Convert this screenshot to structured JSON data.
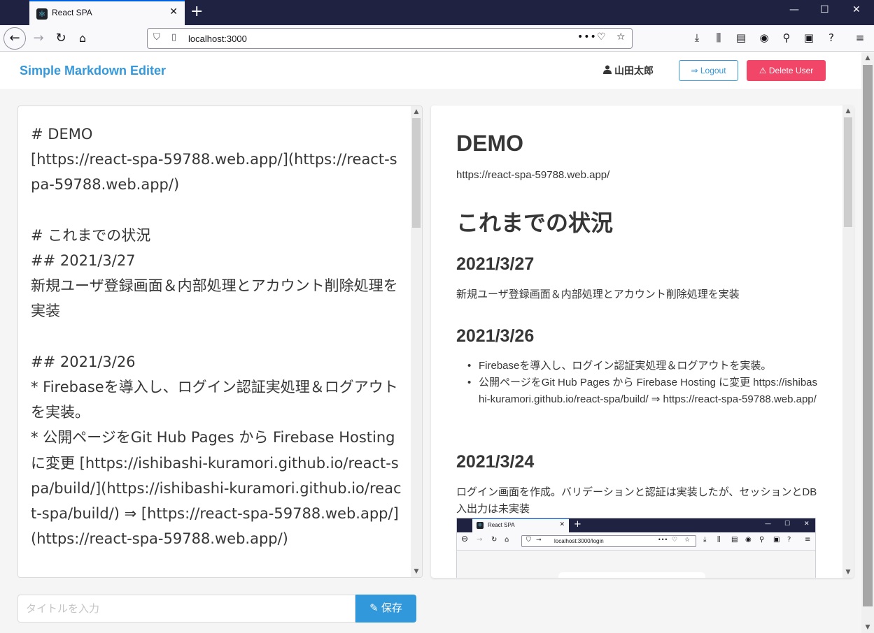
{
  "browser": {
    "tab_title": "React SPA",
    "url": "localhost:3000",
    "new_tab": "+",
    "minimize": "—",
    "maximize": "☐",
    "close": "✕"
  },
  "header": {
    "brand": "Simple Markdown Editer",
    "username": "山田太郎",
    "logout_label": "Logout",
    "delete_label": "Delete User"
  },
  "editor": {
    "content": "# DEMO\n[https://react-spa-59788.web.app/](https://react-spa-59788.web.app/)\n\n# これまでの状況\n## 2021/3/27\n新規ユーザ登録画面＆内部処理とアカウント削除処理を実装\n\n## 2021/3/26\n* Firebaseを導入し、ログイン認証実処理＆ログアウトを実装。\n* 公開ページをGit Hub Pages から Firebase Hosting に変更 [https://ishibashi-kuramori.github.io/react-spa/build/](https://ishibashi-kuramori.github.io/react-spa/build/) ⇒ [https://react-spa-59788.web.app/](https://react-spa-59788.web.app/)"
  },
  "preview": {
    "h1_demo": "DEMO",
    "demo_link": "https://react-spa-59788.web.app/",
    "h1_status": "これまでの状況",
    "sections": [
      {
        "date": "2021/3/27",
        "text": "新規ユーザ登録画面＆内部処理とアカウント削除処理を実装"
      },
      {
        "date": "2021/3/26",
        "items": [
          "Firebaseを導入し、ログイン認証実処理＆ログアウトを実装。",
          "公開ページをGit Hub Pages から Firebase Hosting に変更 https://ishibashi-kuramori.github.io/react-spa/build/ ⇒ https://react-spa-59788.web.app/"
        ]
      },
      {
        "date": "2021/3/24",
        "text": "ログイン画面を作成。バリデーションと認証は実装したが、セッションとDB入出力は未実装"
      }
    ],
    "embedded_screenshot": {
      "tab_title": "React SPA",
      "url": "localhost:3000/login"
    }
  },
  "footer": {
    "title_placeholder": "タイトルを入力",
    "title_value": "",
    "save_label": "保存"
  }
}
